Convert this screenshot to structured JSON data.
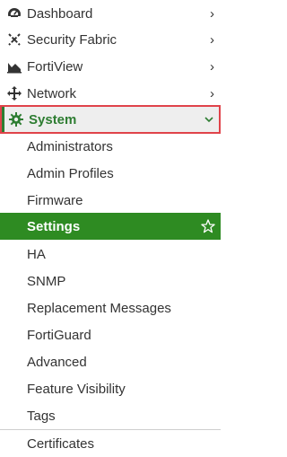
{
  "menu": {
    "top_items": [
      {
        "label": "Dashboard",
        "icon": "dashboard-icon"
      },
      {
        "label": "Security Fabric",
        "icon": "security-fabric-icon"
      },
      {
        "label": "FortiView",
        "icon": "fortiview-icon"
      },
      {
        "label": "Network",
        "icon": "network-icon"
      },
      {
        "label": "System",
        "icon": "gear-icon",
        "expanded": true
      }
    ],
    "system_subitems": [
      {
        "label": "Administrators"
      },
      {
        "label": "Admin Profiles"
      },
      {
        "label": "Firmware"
      },
      {
        "label": "Settings",
        "active": true
      },
      {
        "label": "HA"
      },
      {
        "label": "SNMP"
      },
      {
        "label": "Replacement Messages"
      },
      {
        "label": "FortiGuard"
      },
      {
        "label": "Advanced"
      },
      {
        "label": "Feature Visibility"
      },
      {
        "label": "Tags"
      },
      {
        "label": "Certificates"
      }
    ]
  },
  "colors": {
    "accent_green": "#2e8b22",
    "highlight_border_red": "#e0434a",
    "text": "#333333"
  }
}
